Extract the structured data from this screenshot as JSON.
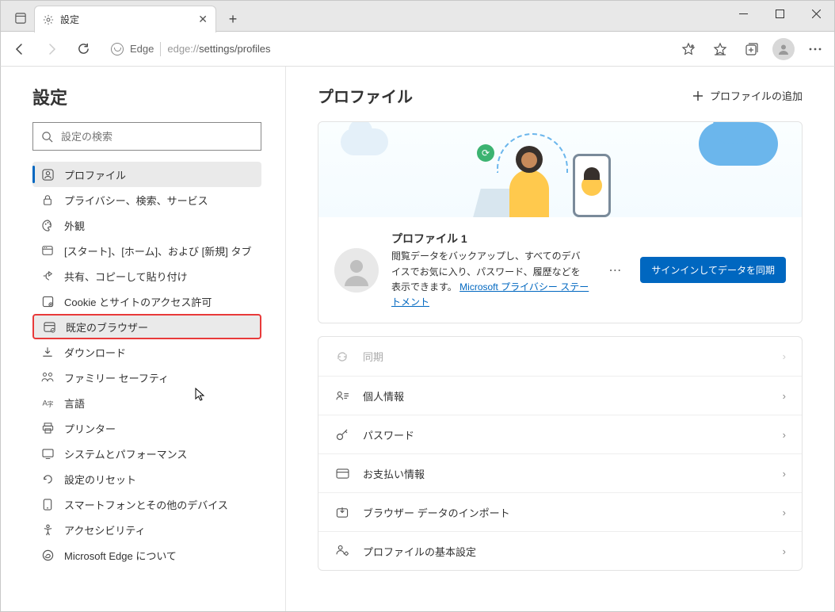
{
  "tab": {
    "title": "設定"
  },
  "address": {
    "brand": "Edge",
    "url_prefix": "edge://",
    "url_path": "settings/profiles"
  },
  "sidebar": {
    "title": "設定",
    "search_placeholder": "設定の検索",
    "items": [
      {
        "label": "プロファイル"
      },
      {
        "label": "プライバシー、検索、サービス"
      },
      {
        "label": "外観"
      },
      {
        "label": "[スタート]、[ホーム]、および [新規] タブ"
      },
      {
        "label": "共有、コピーして貼り付け"
      },
      {
        "label": "Cookie とサイトのアクセス許可"
      },
      {
        "label": "既定のブラウザー"
      },
      {
        "label": "ダウンロード"
      },
      {
        "label": "ファミリー セーフティ"
      },
      {
        "label": "言語"
      },
      {
        "label": "プリンター"
      },
      {
        "label": "システムとパフォーマンス"
      },
      {
        "label": "設定のリセット"
      },
      {
        "label": "スマートフォンとその他のデバイス"
      },
      {
        "label": "アクセシビリティ"
      },
      {
        "label": "Microsoft Edge について"
      }
    ]
  },
  "main": {
    "title": "プロファイル",
    "add_profile": "プロファイルの追加",
    "profile": {
      "name": "プロファイル 1",
      "desc": "閲覧データをバックアップし、すべてのデバイスでお気に入り、パスワード、履歴などを表示できます。",
      "link": "Microsoft プライバシー ステートメント",
      "signin": "サインインしてデータを同期"
    },
    "options": [
      {
        "label": "同期",
        "disabled": true
      },
      {
        "label": "個人情報"
      },
      {
        "label": "パスワード"
      },
      {
        "label": "お支払い情報"
      },
      {
        "label": "ブラウザー データのインポート"
      },
      {
        "label": "プロファイルの基本設定"
      }
    ]
  }
}
